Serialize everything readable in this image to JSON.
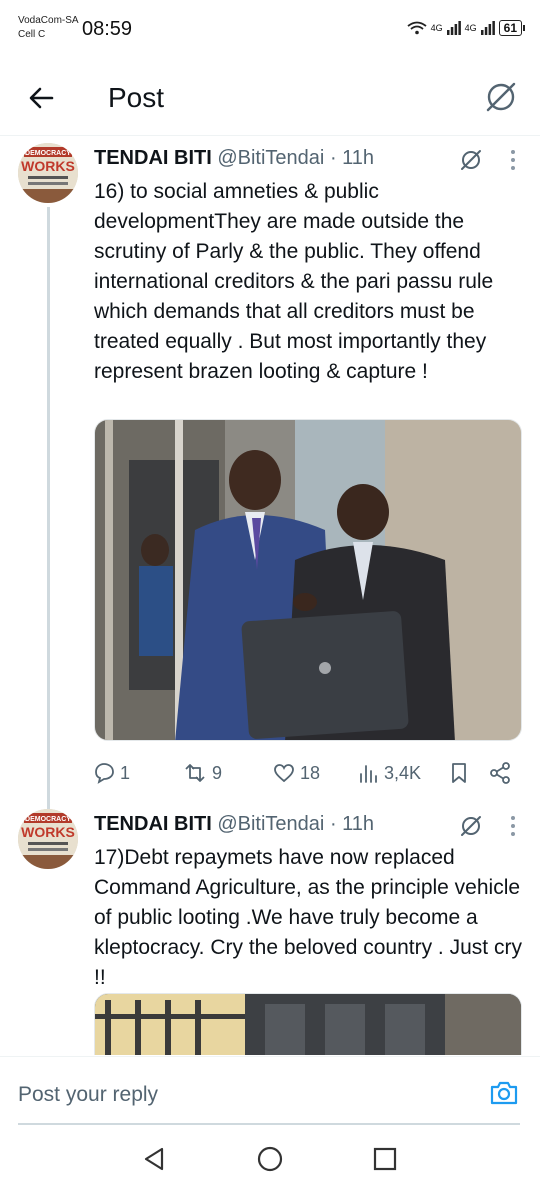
{
  "status_bar": {
    "carrier_line1": "VodaCom-SA",
    "carrier_line2": "Cell C",
    "time": "08:59",
    "net1": "4G",
    "net2": "4G",
    "battery": "61"
  },
  "header": {
    "title": "Post"
  },
  "posts": [
    {
      "author": "TENDAI BITI",
      "handle": "@BitiTendai",
      "time": "· 11h",
      "avatar_text_top": "DEMOCRACY",
      "avatar_text_main": "WORKS",
      "text": "16) to social amneties & public developmentThey are made outside the scrutiny of Parly & the public. They offend international creditors & the pari passu rule which demands that all creditors must be treated equally . But most importantly they represent brazen looting & capture !",
      "actions": {
        "replies": "1",
        "reposts": "9",
        "likes": "18",
        "views": "3,4K"
      }
    },
    {
      "author": "TENDAI BITI",
      "handle": "@BitiTendai",
      "time": "· 11h",
      "avatar_text_top": "DEMOCRACY",
      "avatar_text_main": "WORKS",
      "text": "17)Debt repaymets have now replaced Command Agriculture, as the principle vehicle of public looting .We have truly become a kleptocracy. Cry the beloved country . Just cry !!"
    }
  ],
  "reply": {
    "placeholder": "Post your reply"
  },
  "colors": {
    "text": "#0f1419",
    "secondary": "#536471",
    "accent": "#1d9bf0",
    "divider": "#eff3f4"
  },
  "icons": [
    "back-arrow-icon",
    "grok-icon",
    "more-icon",
    "reply-icon",
    "repost-icon",
    "like-icon",
    "views-icon",
    "bookmark-icon",
    "share-icon",
    "camera-icon",
    "nav-back-icon",
    "nav-home-icon",
    "nav-recents-icon"
  ]
}
